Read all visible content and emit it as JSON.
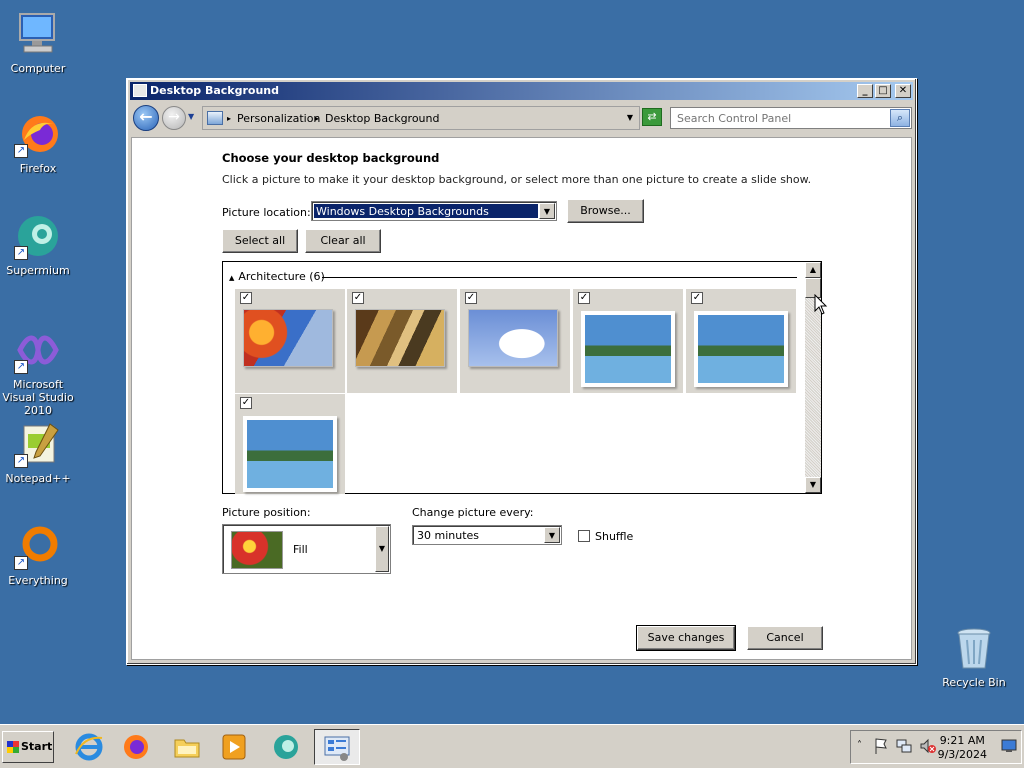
{
  "desktop": {
    "icons": [
      {
        "label": "Computer"
      },
      {
        "label": "Firefox"
      },
      {
        "label": "Supermium"
      },
      {
        "label": "Microsoft Visual Studio 2010"
      },
      {
        "label": "Notepad++"
      },
      {
        "label": "Everything"
      },
      {
        "label": "Recycle Bin"
      }
    ]
  },
  "window": {
    "title": "Desktop Background",
    "breadcrumb": [
      "Personalization",
      "Desktop Background"
    ],
    "search_placeholder": "Search Control Panel",
    "heading": "Choose your desktop background",
    "description": "Click a picture to make it your desktop background, or select more than one picture to create a slide show.",
    "picture_location_label": "Picture location:",
    "picture_location_value": "Windows Desktop Backgrounds",
    "browse_label": "Browse...",
    "select_all_label": "Select all",
    "clear_all_label": "Clear all",
    "group_label": "Architecture (6)",
    "picture_position_label": "Picture position:",
    "picture_position_value": "Fill",
    "change_every_label": "Change picture every:",
    "change_every_value": "30 minutes",
    "shuffle_label": "Shuffle",
    "save_label": "Save changes",
    "cancel_label": "Cancel"
  },
  "taskbar": {
    "start_label": "Start",
    "time": "9:21 AM",
    "date": "9/3/2024"
  }
}
